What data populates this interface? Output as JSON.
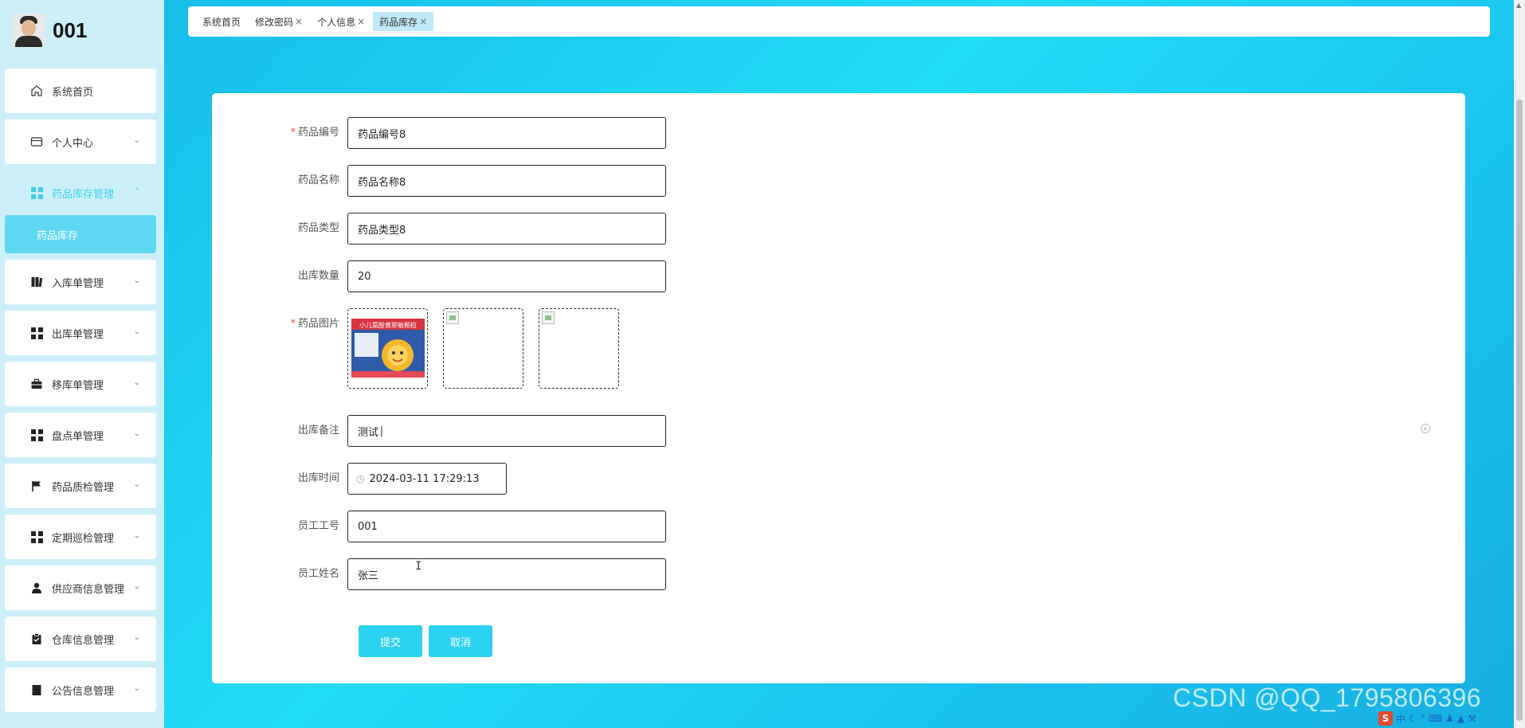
{
  "profile": {
    "name": "001"
  },
  "sidebar": {
    "items": [
      {
        "label": "系统首页",
        "icon": "home-icon"
      },
      {
        "label": "个人中心",
        "icon": "card-icon"
      },
      {
        "label": "药品库存管理",
        "icon": "grid-icon",
        "active": true
      },
      {
        "label": "入库单管理",
        "icon": "book-icon"
      },
      {
        "label": "出库单管理",
        "icon": "grid-icon"
      },
      {
        "label": "移库单管理",
        "icon": "briefcase-icon"
      },
      {
        "label": "盘点单管理",
        "icon": "grid-icon"
      },
      {
        "label": "药品质检管理",
        "icon": "flag-icon"
      },
      {
        "label": "定期巡检管理",
        "icon": "grid-icon"
      },
      {
        "label": "供应商信息管理",
        "icon": "user-icon"
      },
      {
        "label": "仓库信息管理",
        "icon": "clipboard-icon"
      },
      {
        "label": "公告信息管理",
        "icon": "doc-icon"
      }
    ],
    "submenu": {
      "label": "药品库存"
    }
  },
  "tabs": [
    {
      "label": "系统首页",
      "closable": false
    },
    {
      "label": "修改密码",
      "closable": true
    },
    {
      "label": "个人信息",
      "closable": true
    },
    {
      "label": "药品库存",
      "closable": true,
      "active": true
    }
  ],
  "tab_close_glyph": "×",
  "form": {
    "drug_code": {
      "label": "药品编号",
      "value": "药品编号8",
      "required": true
    },
    "drug_name": {
      "label": "药品名称",
      "value": "药品名称8"
    },
    "drug_type": {
      "label": "药品类型",
      "value": "药品类型8"
    },
    "out_qty": {
      "label": "出库数量",
      "value": "20"
    },
    "drug_images": {
      "label": "药品图片",
      "required": true,
      "count": 3
    },
    "out_remark": {
      "label": "出库备注",
      "value": "测试"
    },
    "out_time": {
      "label": "出库时间",
      "value": "2024-03-11 17:29:13"
    },
    "employee_id": {
      "label": "员工工号",
      "value": "001"
    },
    "employee_name": {
      "label": "员工姓名",
      "value": "张三"
    },
    "required_mark": "*",
    "submit_label": "提交",
    "cancel_label": "取消"
  },
  "package_text": "小儿氨酚黄那敏颗粒",
  "watermark": "CSDN @QQ_1795806396",
  "ime": {
    "logo": "S",
    "lang": "中"
  },
  "colors": {
    "accent": "#2bd2f0",
    "sidebar_bg": "#ccf0fa",
    "active_text": "#3ccfea",
    "submenu_bg": "#5fd8f3"
  }
}
